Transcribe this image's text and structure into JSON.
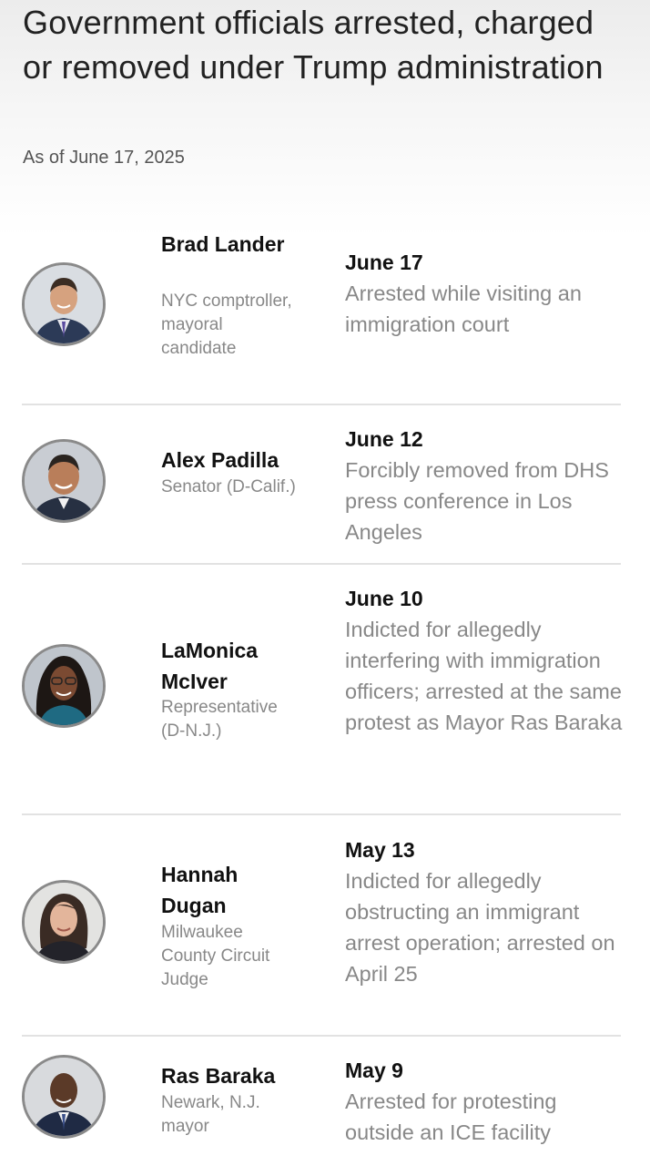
{
  "header": {
    "title": "Government officials arrested, charged or removed under Trump administration",
    "as_of": "As of June 17, 2025"
  },
  "officials": [
    {
      "name": "Brad Lander",
      "role": "NYC comptroller, mayoral candidate",
      "date": "June 17",
      "description": "Arrested while visiting an immigration court",
      "avatar_icon": "portrait-icon"
    },
    {
      "name": "Alex Padilla",
      "role": "Senator (D-Calif.)",
      "date": "June 12",
      "description": "Forcibly removed from DHS press conference in Los Angeles",
      "avatar_icon": "portrait-icon"
    },
    {
      "name": "LaMonica McIver",
      "role": "Representative (D-N.J.)",
      "date": "June 10",
      "description": "Indicted for allegedly interfering with immigration officers; arrested at the same protest as Mayor Ras Baraka",
      "avatar_icon": "portrait-icon"
    },
    {
      "name": "Hannah Dugan",
      "role": "Milwaukee County Circuit Judge",
      "date": "May 13",
      "description": "Indicted for allegedly obstructing an immigrant arrest operation; arrested on April 25",
      "avatar_icon": "portrait-icon"
    },
    {
      "name": "Ras Baraka",
      "role": "Newark, N.J. mayor",
      "date": "May 9",
      "description": "Arrested for protesting outside an ICE facility",
      "avatar_icon": "portrait-icon"
    }
  ]
}
